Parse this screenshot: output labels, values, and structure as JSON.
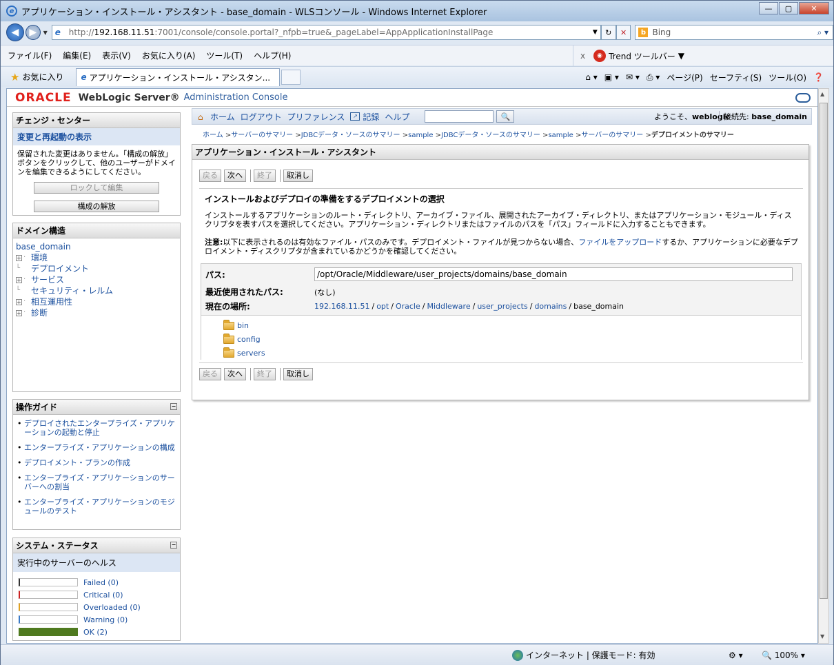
{
  "window": {
    "title": "アプリケーション・インストール・アシスタント - base_domain - WLSコンソール - Windows Internet Explorer"
  },
  "browser": {
    "url_prefix": "http://",
    "url_host": "192.168.11.51",
    "url_rest": ":7001/console/console.portal?_nfpb=true&_pageLabel=AppApplicationInstallPage",
    "search_engine": "Bing",
    "menus": [
      "ファイル(F)",
      "編集(E)",
      "表示(V)",
      "お気に入り(A)",
      "ツール(T)",
      "ヘルプ(H)"
    ],
    "trend_toolbar": "Trend ツールバー",
    "favorites": "お気に入り",
    "tab_title": "アプリケーション・インストール・アシスタン...",
    "cmd": [
      "ページ(P)",
      "セーフティ(S)",
      "ツール(O)"
    ],
    "status_zone": "インターネット | 保護モード: 有効",
    "zoom": "100%"
  },
  "console": {
    "brand": "ORACLE",
    "product": "WebLogic Server®",
    "subtitle": "Administration Console"
  },
  "change_center": {
    "title": "チェンジ・センター",
    "link": "変更と再起動の表示",
    "message": "保留された変更はありません。「構成の解放」ボタンをクリックして、他のユーザーがドメインを編集できるようにしてください。",
    "lock_btn": "ロックして編集",
    "release_btn": "構成の解放"
  },
  "domain_tree": {
    "title": "ドメイン構造",
    "root": "base_domain",
    "items": [
      {
        "label": "環境",
        "expand": "+"
      },
      {
        "label": "デプロイメント",
        "expand": ""
      },
      {
        "label": "サービス",
        "expand": "+"
      },
      {
        "label": "セキュリティ・レルム",
        "expand": ""
      },
      {
        "label": "相互運用性",
        "expand": "+"
      },
      {
        "label": "診断",
        "expand": "+"
      }
    ]
  },
  "guide": {
    "title": "操作ガイド",
    "items": [
      "デプロイされたエンタープライズ・アプリケーションの起動と停止",
      "エンタープライズ・アプリケーションの構成",
      "デプロイメント・プランの作成",
      "エンタープライズ・アプリケーションのサーバーへの割当",
      "エンタープライズ・アプリケーションのモジュールのテスト"
    ]
  },
  "system_status": {
    "title": "システム・ステータス",
    "subtitle": "実行中のサーバーのヘルス",
    "rows": [
      {
        "label": "Failed (0)",
        "color": "#333333",
        "fill": 0
      },
      {
        "label": "Critical (0)",
        "color": "#cc2222",
        "fill": 0
      },
      {
        "label": "Overloaded (0)",
        "color": "#e0a020",
        "fill": 0
      },
      {
        "label": "Warning (0)",
        "color": "#3a7ac8",
        "fill": 0
      },
      {
        "label": "OK (2)",
        "color": "#4f7a1f",
        "fill": 1
      }
    ]
  },
  "toolbar": {
    "home": "ホーム",
    "logout": "ログアウト",
    "prefs": "プリファレンス",
    "record": "記録",
    "help": "ヘルプ",
    "welcome": "ようこそ、",
    "user": "weblogic",
    "connected": "接続先:",
    "domain": "base_domain"
  },
  "breadcrumb": {
    "items": [
      "ホーム",
      "サーバーのサマリー",
      "JDBCデータ・ソースのサマリー",
      "sample",
      "JDBCデータ・ソースのサマリー",
      "sample",
      "サーバーのサマリー"
    ],
    "current": "デプロイメントのサマリー"
  },
  "main": {
    "title": "アプリケーション・インストール・アシスタント",
    "buttons": {
      "back": "戻る",
      "next": "次へ",
      "finish": "終了",
      "cancel": "取消し"
    },
    "section_title": "インストールおよびデプロイの準備をするデプロイメントの選択",
    "description": "インストールするアプリケーションのルート・ディレクトリ、アーカイブ・ファイル、展開されたアーカイブ・ディレクトリ、またはアプリケーション・モジュール・ディスクリプタを表すパスを選択してください。アプリケーション・ディレクトリまたはファイルのパスを「パス」フィールドに入力することもできます。",
    "note_label": "注意:",
    "note_text1": "以下に表示されるのは有効なファイル・パスのみです。デプロイメント・ファイルが見つからない場合、",
    "note_link": "ファイルをアップロード",
    "note_text2": "するか、アプリケーションに必要なデプロイメント・ディスクリプタが含まれているかどうかを確認してください。",
    "path_label": "パス:",
    "path_value": "/opt/Oracle/Middleware/user_projects/domains/base_domain",
    "recent_label": "最近使用されたパス:",
    "recent_value": "(なし)",
    "location_label": "現在の場所:",
    "location_parts": [
      "192.168.11.51",
      "opt",
      "Oracle",
      "Middleware",
      "user_projects",
      "domains"
    ],
    "location_last": "base_domain",
    "folders": [
      "bin",
      "config",
      "servers"
    ]
  }
}
